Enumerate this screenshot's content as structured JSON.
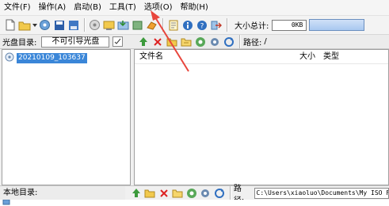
{
  "menu": {
    "items": [
      "文件(F)",
      "操作(A)",
      "启动(B)",
      "工具(T)",
      "选项(O)",
      "帮助(H)"
    ]
  },
  "toolbar": {
    "total_label": "大小总计:",
    "total_value": "0KB"
  },
  "disc_pane": {
    "label": "光盘目录:",
    "disc_name": "不可引导光盘",
    "tree_item": "20210109_103637"
  },
  "file_pane": {
    "path_label": "路径:",
    "path_value": "/",
    "columns": [
      "文件名",
      "大小",
      "类型"
    ]
  },
  "local_pane": {
    "label": "本地目录:",
    "path_label": "路径:",
    "path_value": "C:\\Users\\xiaoluo\\Documents\\My ISO Files"
  },
  "colors": {
    "highlight": "#3a86d8",
    "annotation_arrow": "#e8453c"
  },
  "icons": [
    "new-icon",
    "open-icon",
    "save-icon",
    "burn-icon",
    "refresh-icon",
    "properties-icon",
    "info-icon",
    "help-icon",
    "exit-icon"
  ]
}
